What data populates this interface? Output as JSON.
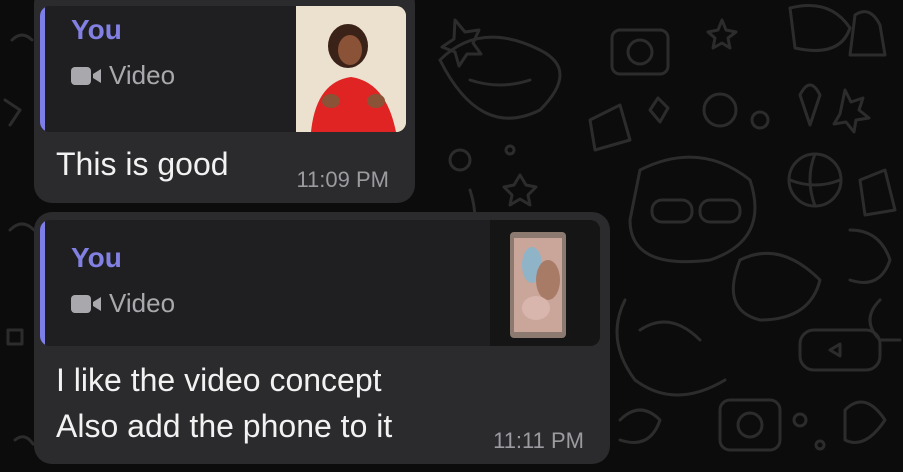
{
  "colors": {
    "background": "#0c0c0c",
    "bubble": "#2b2b2d",
    "quote_bg": "#1f1f21",
    "accent": "#7d7ee8",
    "text": "#f2f2f2",
    "meta": "#9b9ba0"
  },
  "messages": [
    {
      "reply": {
        "author": "You",
        "type_label": "Video",
        "type_icon": "video-camera-icon",
        "thumbnail": "video-thumbnail-woman-red-shirt"
      },
      "text": "This is good",
      "time": "11:09 PM"
    },
    {
      "reply": {
        "author": "You",
        "type_label": "Video",
        "type_icon": "video-camera-icon",
        "thumbnail": "video-thumbnail-phone-screen"
      },
      "text": "I like the video concept\nAlso add the phone to it",
      "time": "11:11 PM"
    }
  ]
}
